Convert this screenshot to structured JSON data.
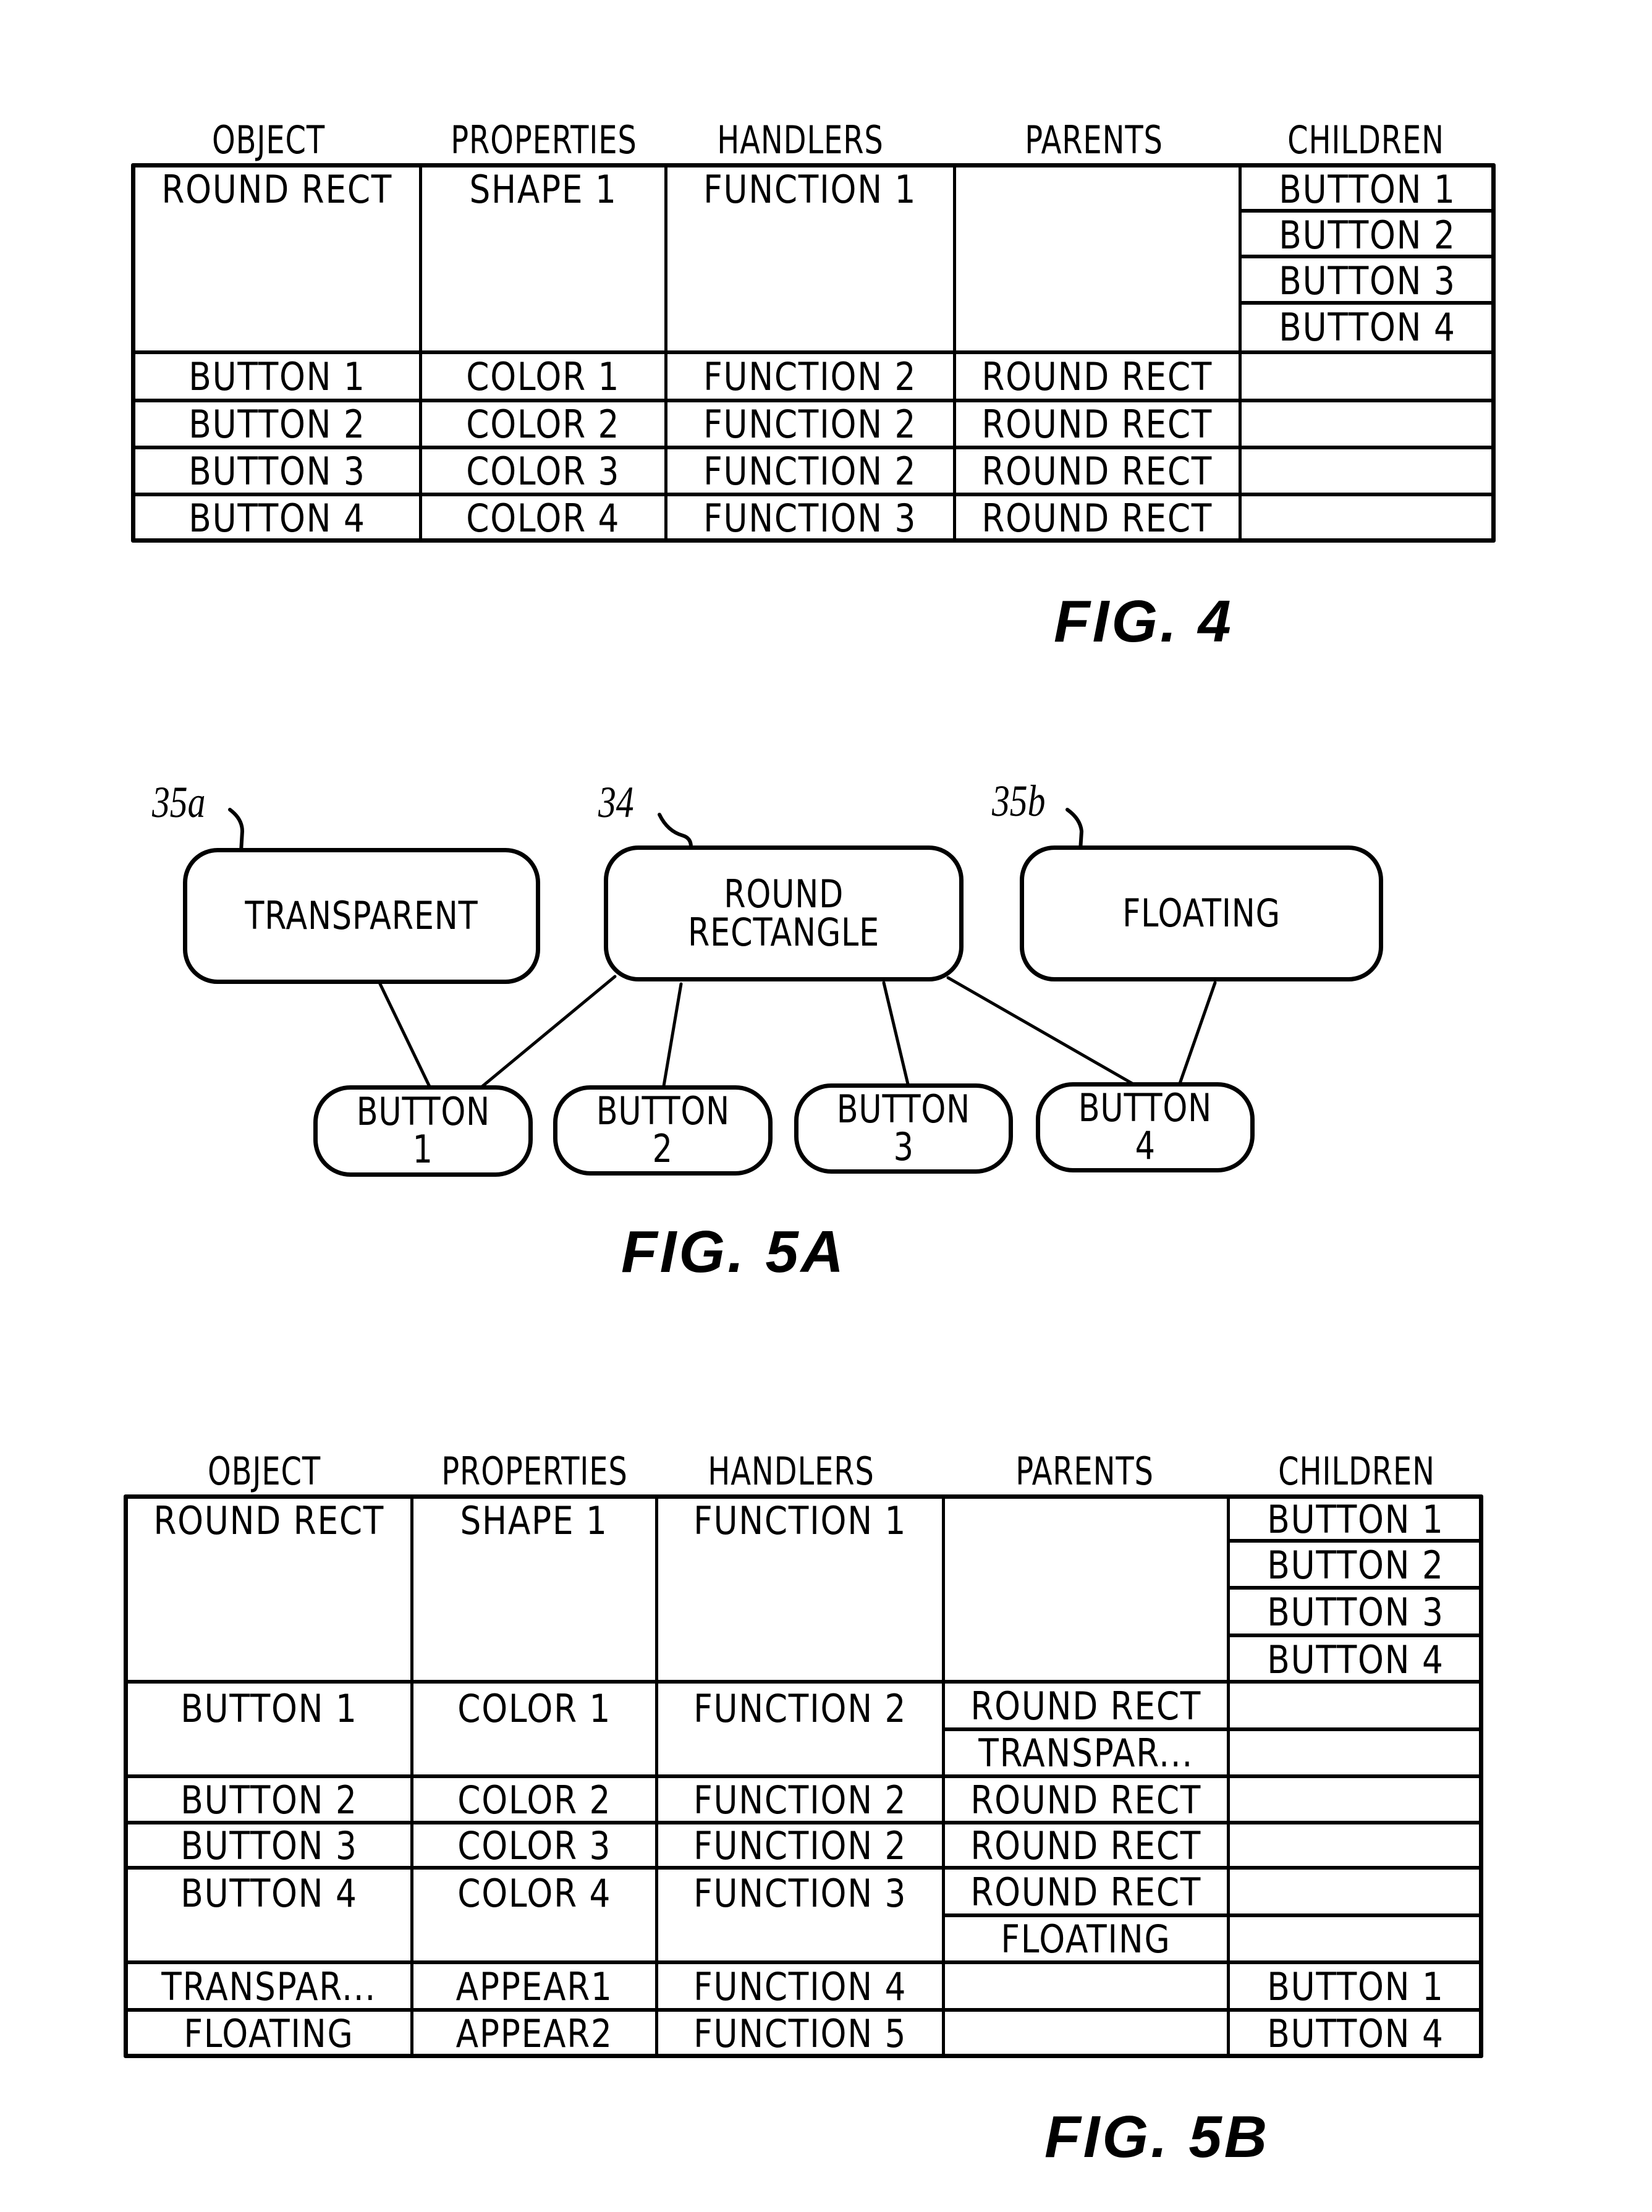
{
  "fig4": {
    "label": "FIG. 4",
    "columns": [
      "OBJECT",
      "PROPERTIES",
      "HANDLERS",
      "PARENTS",
      "CHILDREN"
    ],
    "rows": [
      {
        "object": "ROUND RECT",
        "properties": "SHAPE 1",
        "handlers": "FUNCTION 1",
        "parents": [],
        "children": [
          "BUTTON 1",
          "BUTTON 2",
          "BUTTON 3",
          "BUTTON 4"
        ]
      },
      {
        "object": "BUTTON 1",
        "properties": "COLOR 1",
        "handlers": "FUNCTION 2",
        "parents": [
          "ROUND RECT"
        ],
        "children": []
      },
      {
        "object": "BUTTON 2",
        "properties": "COLOR 2",
        "handlers": "FUNCTION 2",
        "parents": [
          "ROUND RECT"
        ],
        "children": []
      },
      {
        "object": "BUTTON 3",
        "properties": "COLOR 3",
        "handlers": "FUNCTION 2",
        "parents": [
          "ROUND RECT"
        ],
        "children": []
      },
      {
        "object": "BUTTON 4",
        "properties": "COLOR 4",
        "handlers": "FUNCTION 3",
        "parents": [
          "ROUND RECT"
        ],
        "children": []
      }
    ]
  },
  "fig5a": {
    "label": "FIG. 5A",
    "parents": [
      {
        "id": "transparent",
        "ref": "35a",
        "lines": [
          "TRANSPARENT"
        ]
      },
      {
        "id": "round-rect",
        "ref": "34",
        "lines": [
          "ROUND",
          "RECTANGLE"
        ]
      },
      {
        "id": "floating",
        "ref": "35b",
        "lines": [
          "FLOATING"
        ]
      }
    ],
    "buttons": [
      {
        "id": "button-1",
        "lines": [
          "BUTTON",
          "1"
        ]
      },
      {
        "id": "button-2",
        "lines": [
          "BUTTON",
          "2"
        ]
      },
      {
        "id": "button-3",
        "lines": [
          "BUTTON",
          "3"
        ]
      },
      {
        "id": "button-4",
        "lines": [
          "BUTTON",
          "4"
        ]
      }
    ],
    "edges": [
      {
        "from": "transparent",
        "to": "button-1"
      },
      {
        "from": "round-rect",
        "to": "button-1"
      },
      {
        "from": "round-rect",
        "to": "button-2"
      },
      {
        "from": "round-rect",
        "to": "button-3"
      },
      {
        "from": "round-rect",
        "to": "button-4"
      },
      {
        "from": "floating",
        "to": "button-4"
      }
    ]
  },
  "fig5b": {
    "label": "FIG. 5B",
    "columns": [
      "OBJECT",
      "PROPERTIES",
      "HANDLERS",
      "PARENTS",
      "CHILDREN"
    ],
    "rows": [
      {
        "object": "ROUND RECT",
        "properties": "SHAPE 1",
        "handlers": "FUNCTION 1",
        "parents": [],
        "children": [
          "BUTTON 1",
          "BUTTON 2",
          "BUTTON 3",
          "BUTTON 4"
        ]
      },
      {
        "object": "BUTTON 1",
        "properties": "COLOR 1",
        "handlers": "FUNCTION 2",
        "parents": [
          "ROUND RECT",
          "TRANSPAR..."
        ],
        "children": []
      },
      {
        "object": "BUTTON 2",
        "properties": "COLOR 2",
        "handlers": "FUNCTION 2",
        "parents": [
          "ROUND RECT"
        ],
        "children": []
      },
      {
        "object": "BUTTON 3",
        "properties": "COLOR 3",
        "handlers": "FUNCTION 2",
        "parents": [
          "ROUND RECT"
        ],
        "children": []
      },
      {
        "object": "BUTTON 4",
        "properties": "COLOR 4",
        "handlers": "FUNCTION 3",
        "parents": [
          "ROUND RECT",
          "FLOATING"
        ],
        "children": []
      },
      {
        "object": "TRANSPAR...",
        "properties": "APPEAR1",
        "handlers": "FUNCTION 4",
        "parents": [],
        "children": [
          "BUTTON 1"
        ]
      },
      {
        "object": "FLOATING",
        "properties": "APPEAR2",
        "handlers": "FUNCTION 5",
        "parents": [],
        "children": [
          "BUTTON 4"
        ]
      }
    ]
  }
}
